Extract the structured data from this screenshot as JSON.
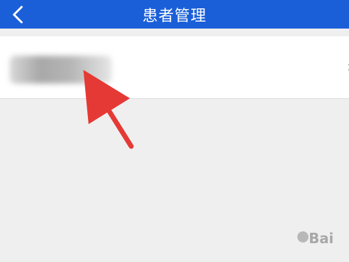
{
  "header": {
    "title": "患者管理",
    "back_icon": "chevron-left-icon",
    "background": "#1a5fd8"
  },
  "list": {
    "item_chevron": "›"
  },
  "watermark": {
    "text": "Bai"
  }
}
